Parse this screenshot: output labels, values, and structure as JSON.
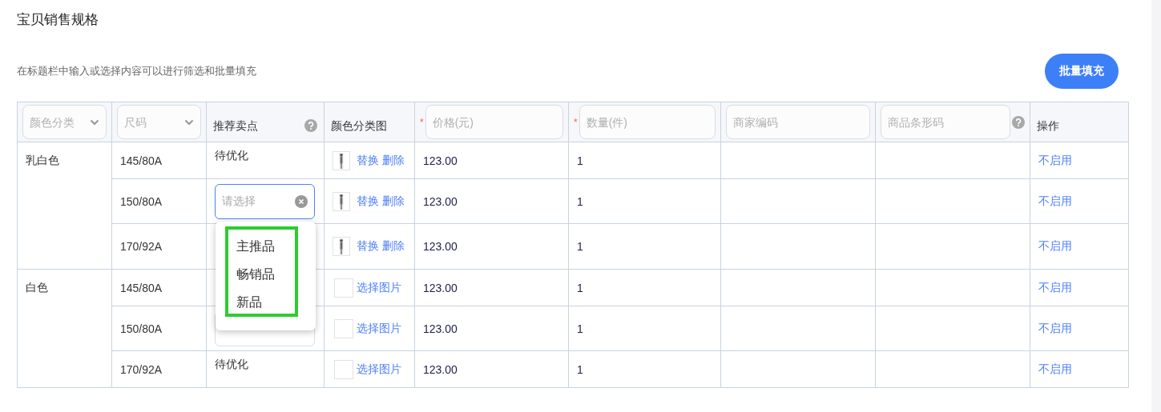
{
  "header": {
    "title": "宝贝销售规格",
    "hint": "在标题栏中输入或选择内容可以进行筛选和批量填充",
    "batch_button": "批量填充"
  },
  "table": {
    "columns": [
      {
        "kind": "select",
        "placeholder": "颜色分类"
      },
      {
        "kind": "select",
        "placeholder": "尺码"
      },
      {
        "kind": "label",
        "label": "推荐卖点",
        "help": true
      },
      {
        "kind": "label",
        "label": "颜色分类图",
        "help": false
      },
      {
        "kind": "input",
        "placeholder": "价格(元)",
        "required_mark": "*"
      },
      {
        "kind": "input",
        "placeholder": "数量(件)",
        "required_mark": "*"
      },
      {
        "kind": "input",
        "placeholder": "商家编码",
        "help": false
      },
      {
        "kind": "input",
        "placeholder": "商品条形码",
        "help": true
      },
      {
        "kind": "label",
        "label": "操作",
        "help": false
      }
    ],
    "groups": [
      {
        "color_name": "乳白色",
        "rows": [
          {
            "size": "145/80A",
            "selling_point": {
              "kind": "text",
              "value": "待优化"
            },
            "image": {
              "kind": "thumbnail",
              "actions": [
                "替换",
                "删除"
              ]
            },
            "price": "123.00",
            "quantity": "1",
            "action": "不启用"
          },
          {
            "size": "150/80A",
            "selling_point": {
              "kind": "select",
              "placeholder": "请选择",
              "focused": true,
              "clear_button": true
            },
            "image": {
              "kind": "thumbnail",
              "actions": [
                "替换",
                "删除"
              ]
            },
            "price": "123.00",
            "quantity": "1",
            "action": "不启用"
          },
          {
            "size": "170/92A",
            "image": {
              "kind": "thumbnail",
              "actions": [
                "替换",
                "删除"
              ]
            },
            "price": "123.00",
            "quantity": "1",
            "action": "不启用"
          }
        ]
      },
      {
        "color_name": "白色",
        "rows": [
          {
            "size": "145/80A",
            "image": {
              "kind": "empty",
              "actions": [
                "选择图片"
              ]
            },
            "price": "123.00",
            "quantity": "1",
            "action": "不启用"
          },
          {
            "size": "150/80A",
            "selling_point": {
              "kind": "select",
              "focused": false,
              "clear_button": false
            },
            "image": {
              "kind": "empty",
              "actions": [
                "选择图片"
              ]
            },
            "price": "123.00",
            "quantity": "1",
            "action": "不启用"
          },
          {
            "size": "170/92A",
            "selling_point": {
              "kind": "text",
              "value": "待优化"
            },
            "image": {
              "kind": "empty",
              "actions": [
                "选择图片"
              ]
            },
            "price": "123.00",
            "quantity": "1",
            "action": "不启用"
          }
        ]
      }
    ]
  },
  "dropdown": {
    "options": [
      "主推品",
      "畅销品",
      "新品"
    ],
    "highlighted": true
  }
}
